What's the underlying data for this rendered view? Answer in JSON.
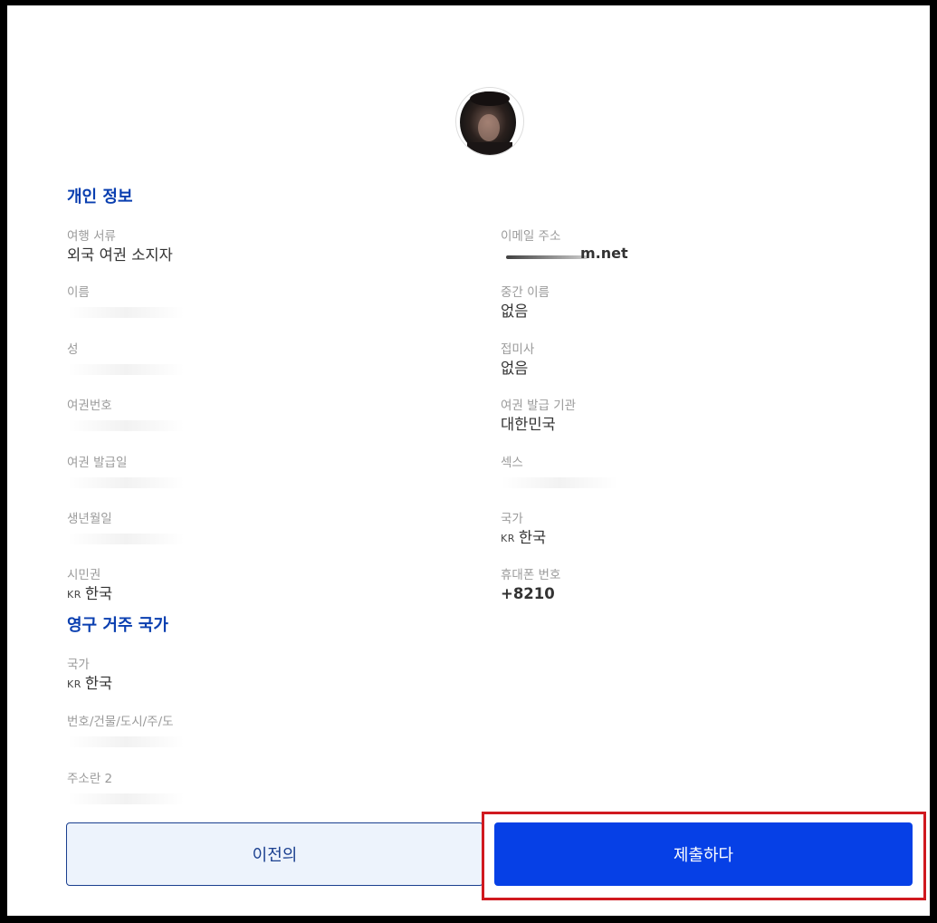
{
  "personal": {
    "title": "개인 정보",
    "fields": [
      {
        "label": "여행 서류",
        "value": "외국 여권 소지자"
      },
      {
        "label": "이메일 주소",
        "value": "m.net"
      },
      {
        "label": "이름",
        "value": ""
      },
      {
        "label": "중간 이름",
        "value": "없음"
      },
      {
        "label": "성",
        "value": ""
      },
      {
        "label": "접미사",
        "value": "없음"
      },
      {
        "label": "여권번호",
        "value": ""
      },
      {
        "label": "여권 발급 기관",
        "value": "대한민국"
      },
      {
        "label": "여권 발급일",
        "value": ""
      },
      {
        "label": "섹스",
        "value": ""
      },
      {
        "label": "생년월일",
        "value": ""
      },
      {
        "label": "국가",
        "code": "KR",
        "value": "한국"
      },
      {
        "label": "시민권",
        "code": "KR",
        "value": "한국"
      },
      {
        "label": "휴대폰 번호",
        "value": "+8210"
      }
    ]
  },
  "residence": {
    "title": "영구 거주 국가",
    "fields": [
      {
        "label": "국가",
        "code": "KR",
        "value": "한국"
      },
      {
        "label": "번호/건물/도시/주/도",
        "value": ""
      },
      {
        "label": "주소란 2",
        "value": ""
      }
    ]
  },
  "buttons": {
    "previous": "이전의",
    "submit": "제출하다"
  }
}
